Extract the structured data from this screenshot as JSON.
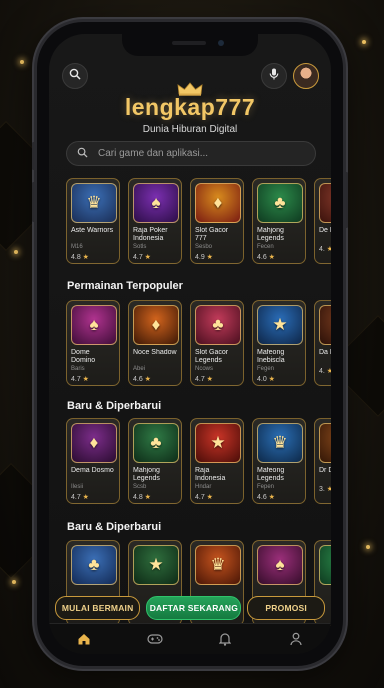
{
  "app": {
    "title": "lengkap777",
    "tagline": "Dunia Hiburan Digital"
  },
  "search": {
    "placeholder": "Cari game dan aplikasi..."
  },
  "rows": [
    {
      "title": "",
      "items": [
        {
          "name": "Aste Warriors",
          "sub": "M16",
          "rating": "4.8",
          "colors": [
            "#3b6fb6",
            "#1a2d55"
          ]
        },
        {
          "name": "Raja Poker Indonesia",
          "sub": "Sotls",
          "rating": "4.7",
          "colors": [
            "#7b2fb0",
            "#2c0e47"
          ]
        },
        {
          "name": "Slot Gacor 777",
          "sub": "Sesbo",
          "rating": "4.9",
          "colors": [
            "#d88b1d",
            "#7a1b12"
          ]
        },
        {
          "name": "Mahjong Legends",
          "sub": "Fecen",
          "rating": "4.6",
          "colors": [
            "#2c8a4a",
            "#0f3a20"
          ]
        },
        {
          "name": "De Da",
          "sub": "",
          "rating": "4.",
          "colors": [
            "#8a3b2c",
            "#3a120c"
          ]
        }
      ]
    },
    {
      "title": "Permainan Terpopuler",
      "items": [
        {
          "name": "Dome Domino",
          "sub": "Baris",
          "rating": "4.7",
          "colors": [
            "#b0338f",
            "#3e0d37"
          ]
        },
        {
          "name": "Noce Shadow",
          "sub": "Abei",
          "rating": "4.6",
          "colors": [
            "#d2641d",
            "#3d1806"
          ]
        },
        {
          "name": "Slot Gacor Legends",
          "sub": "Ncows",
          "rating": "4.7",
          "colors": [
            "#c23b5a",
            "#4a0f1f"
          ]
        },
        {
          "name": "Mafeong Inebiscla",
          "sub": "Fegen",
          "rating": "4.0",
          "colors": [
            "#2a6db8",
            "#0e2546"
          ]
        },
        {
          "name": "Da Da",
          "sub": "",
          "rating": "4.",
          "colors": [
            "#7b3d1f",
            "#2b1008"
          ]
        }
      ]
    },
    {
      "title": "Baru & Diperbarui",
      "items": [
        {
          "name": "Dema Dosmo",
          "sub": "Ilesii",
          "rating": "4.7",
          "colors": [
            "#7c2d8a",
            "#2a0c30"
          ]
        },
        {
          "name": "Mahjong Legends",
          "sub": "Scsb",
          "rating": "4.8",
          "colors": [
            "#2f7a45",
            "#0e2c18"
          ]
        },
        {
          "name": "Raja Indonesia",
          "sub": "Hndar",
          "rating": "4.7",
          "colors": [
            "#c93427",
            "#4a0d08"
          ]
        },
        {
          "name": "Mafeong Legends",
          "sub": "Fepen",
          "rating": "4.6",
          "colors": [
            "#2b6fb5",
            "#0d2848"
          ]
        },
        {
          "name": "Dr Da",
          "sub": "",
          "rating": "3.",
          "colors": [
            "#8a4a1c",
            "#321606"
          ]
        }
      ]
    },
    {
      "title": "Baru & Diperbarui",
      "items": [
        {
          "name": "",
          "sub": "",
          "rating": "",
          "colors": [
            "#3b6fb6",
            "#132a55"
          ]
        },
        {
          "name": "",
          "sub": "",
          "rating": "",
          "colors": [
            "#2f6e3d",
            "#0e2a16"
          ]
        },
        {
          "name": "",
          "sub": "",
          "rating": "",
          "colors": [
            "#c6541e",
            "#4a1606"
          ]
        },
        {
          "name": "",
          "sub": "",
          "rating": "",
          "colors": [
            "#9b2f7a",
            "#350d2a"
          ]
        },
        {
          "name": "",
          "sub": "",
          "rating": "",
          "colors": [
            "#2a8a4a",
            "#0f3a20"
          ]
        }
      ]
    }
  ],
  "cta": {
    "start": "MULAI BERMAIN",
    "register": "DAFTAR SEKARANG",
    "promo": "PROMOSI"
  },
  "icons": {
    "search": "search-icon",
    "mic": "mic-icon",
    "crown": "crown-icon",
    "tabs": [
      "home-icon",
      "gamepad-icon",
      "bell-icon",
      "profile-icon"
    ]
  },
  "colors": {
    "accent": "#f2c766",
    "gold_border": "#c99a3c",
    "cta_green": "#1f9a52",
    "active_tab": "#e9b44c"
  }
}
